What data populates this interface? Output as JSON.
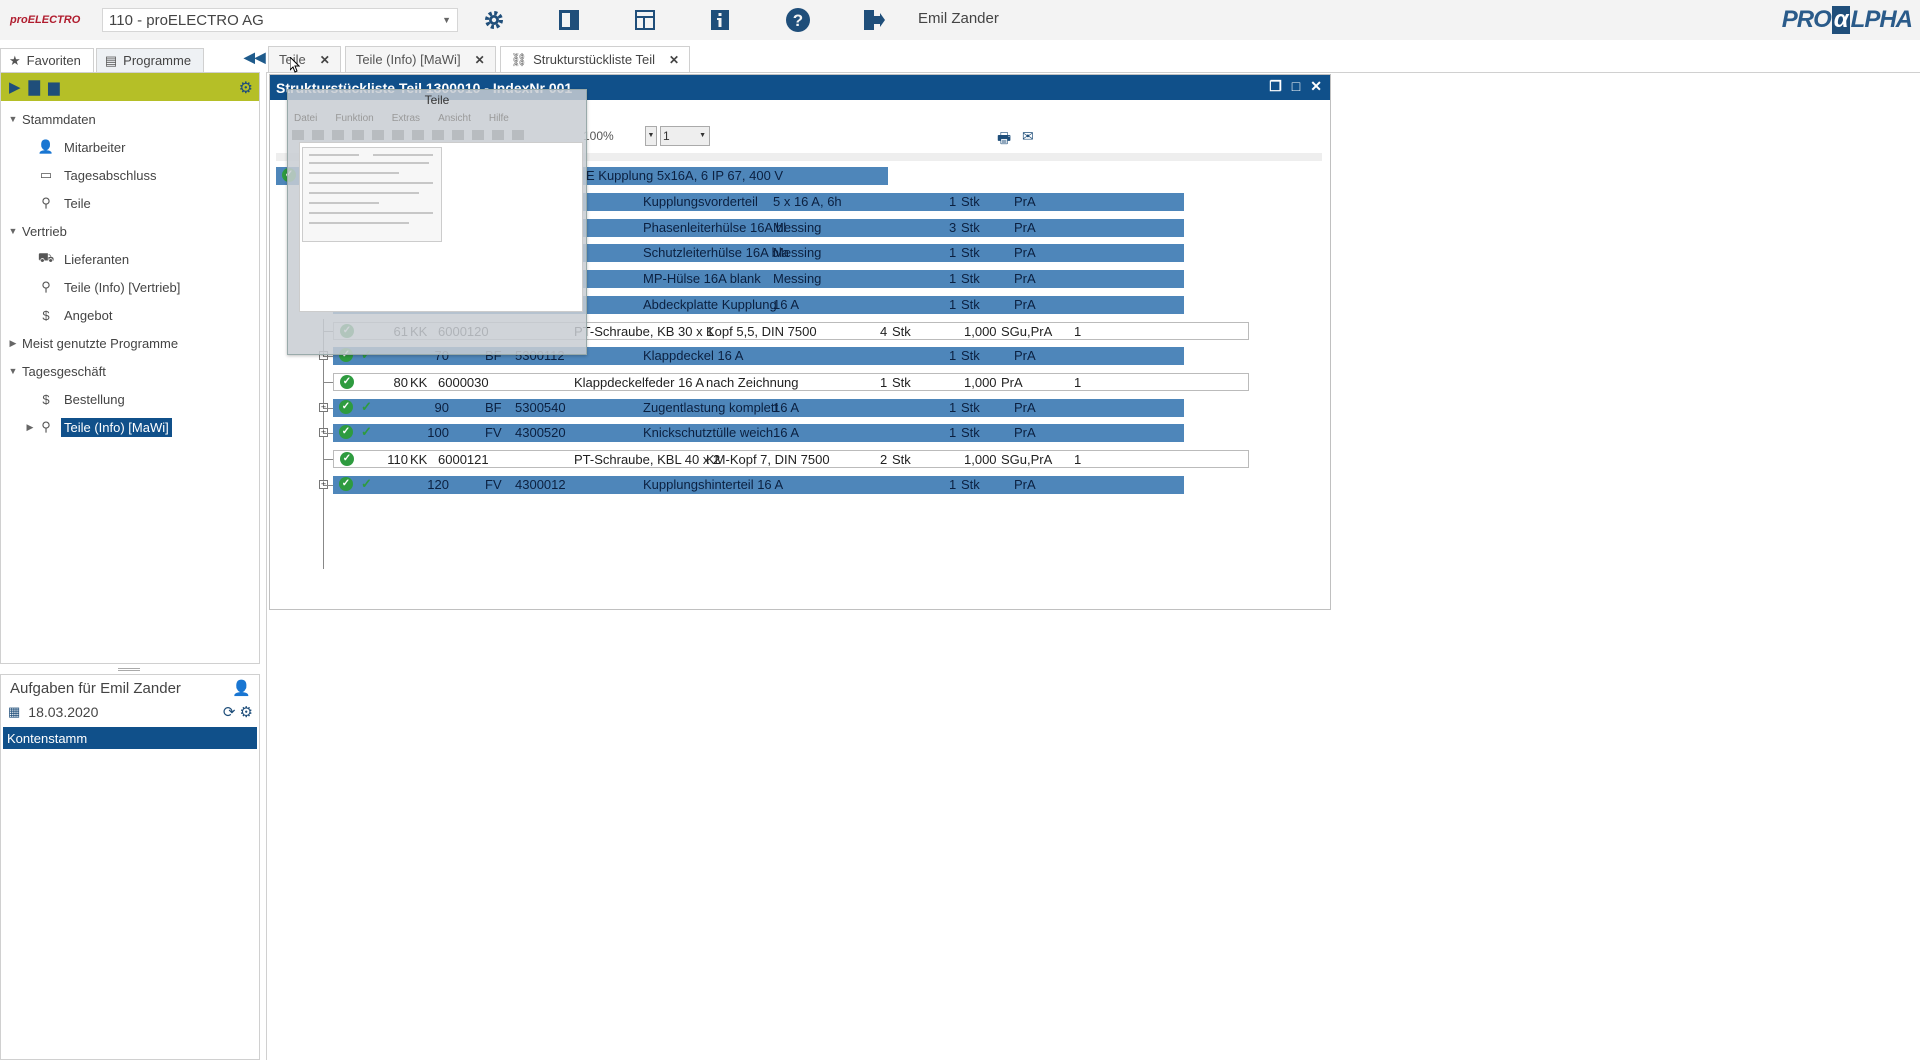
{
  "topbar": {
    "logo_text": "proELECTRO",
    "company": "110 - proELECTRO AG",
    "user": "Emil Zander",
    "brand_pre": "PRO",
    "brand_alpha": "α",
    "brand_post": "LPHA"
  },
  "nav_tabs": [
    {
      "label": "Favoriten",
      "icon": "star-icon"
    },
    {
      "label": "Programme",
      "icon": "programs-icon"
    }
  ],
  "tree": {
    "groups": [
      {
        "label": "Stammdaten",
        "items": [
          "Mitarbeiter",
          "Tagesabschluss",
          "Teile"
        ]
      },
      {
        "label": "Vertrieb",
        "items": [
          "Lieferanten",
          "Teile (Info) [Vertrieb]",
          "Angebot"
        ]
      },
      {
        "label": "Meist genutzte Programme",
        "items": []
      },
      {
        "label": "Tagesgeschäft",
        "items": [
          "Bestellung",
          "Teile (Info) [MaWi]"
        ]
      }
    ]
  },
  "tasks": {
    "title": "Aufgaben für Emil Zander",
    "date": "18.03.2020",
    "items": [
      "Kontenstamm"
    ]
  },
  "doc_tabs": [
    {
      "label": "Teile"
    },
    {
      "label": "Teile (Info) [MaWi]"
    },
    {
      "label": "Strukturstückliste Teil"
    }
  ],
  "window": {
    "title": "Strukturstückliste Teil 1300010 - IndexNr 001",
    "zoom": "100%",
    "level": "1",
    "root_text": "E Kupplung 5x16A, 6    IP 67, 400 V"
  },
  "popup": {
    "title": "Teile",
    "menu": [
      "Datei",
      "Funktion",
      "Extras",
      "Ansicht",
      "Hilfe"
    ]
  },
  "rows": [
    {
      "pos": "",
      "art": "",
      "nr": "",
      "name": "Kupplungsvorderteil",
      "desc": "5 x 16 A, 6h",
      "qty": "1",
      "unit": "Stk",
      "amount": "",
      "who": "PrA",
      "lvl": "",
      "style": "blue"
    },
    {
      "pos": "",
      "art": "",
      "nr": "",
      "name": "Phasenleiterhülse 16A bl",
      "desc": "Messing",
      "qty": "3",
      "unit": "Stk",
      "amount": "",
      "who": "PrA",
      "lvl": "",
      "style": "blue"
    },
    {
      "pos": "",
      "art": "",
      "nr": "",
      "name": "Schutzleiterhülse 16A bla",
      "desc": "Messing",
      "qty": "1",
      "unit": "Stk",
      "amount": "",
      "who": "PrA",
      "lvl": "",
      "style": "blue"
    },
    {
      "pos": "",
      "art": "",
      "nr": "",
      "name": "MP-Hülse 16A blank",
      "desc": "Messing",
      "qty": "1",
      "unit": "Stk",
      "amount": "",
      "who": "PrA",
      "lvl": "",
      "style": "blue"
    },
    {
      "pos": "",
      "art": "",
      "nr": "",
      "name": "Abdeckplatte Kupplung",
      "desc": "16 A",
      "qty": "1",
      "unit": "Stk",
      "amount": "",
      "who": "PrA",
      "lvl": "",
      "style": "blue"
    },
    {
      "pos": "61",
      "art": "KK",
      "nr": "6000120",
      "name": "PT-Schraube, KB 30 x 1",
      "desc": "Kopf 5,5, DIN 7500",
      "qty": "4",
      "unit": "Stk",
      "amount": "1,000",
      "who": "SGu,PrA",
      "lvl": "1",
      "style": "white"
    },
    {
      "pos": "70",
      "art": "BF",
      "nr": "5300112",
      "name": "Klappdeckel 16 A",
      "desc": "",
      "qty": "1",
      "unit": "Stk",
      "amount": "",
      "who": "PrA",
      "lvl": "",
      "style": "blue"
    },
    {
      "pos": "80",
      "art": "KK",
      "nr": "6000030",
      "name": "Klappdeckelfeder 16 A",
      "desc": "nach Zeichnung",
      "qty": "1",
      "unit": "Stk",
      "amount": "1,000",
      "who": "PrA",
      "lvl": "1",
      "style": "white"
    },
    {
      "pos": "90",
      "art": "BF",
      "nr": "5300540",
      "name": "Zugentlastung komplett",
      "desc": "16 A",
      "qty": "1",
      "unit": "Stk",
      "amount": "",
      "who": "PrA",
      "lvl": "",
      "style": "blue"
    },
    {
      "pos": "100",
      "art": "FV",
      "nr": "4300520",
      "name": "Knickschutztülle weich",
      "desc": "16 A",
      "qty": "1",
      "unit": "Stk",
      "amount": "",
      "who": "PrA",
      "lvl": "",
      "style": "blue"
    },
    {
      "pos": "110",
      "art": "KK",
      "nr": "6000121",
      "name": "PT-Schraube, KBL 40 x 2",
      "desc": "KM-Kopf 7, DIN 7500",
      "qty": "2",
      "unit": "Stk",
      "amount": "1,000",
      "who": "SGu,PrA",
      "lvl": "1",
      "style": "white"
    },
    {
      "pos": "120",
      "art": "FV",
      "nr": "4300012",
      "name": "Kupplungshinterteil 16 A",
      "desc": "",
      "qty": "1",
      "unit": "Stk",
      "amount": "",
      "who": "PrA",
      "lvl": "",
      "style": "blue"
    }
  ]
}
